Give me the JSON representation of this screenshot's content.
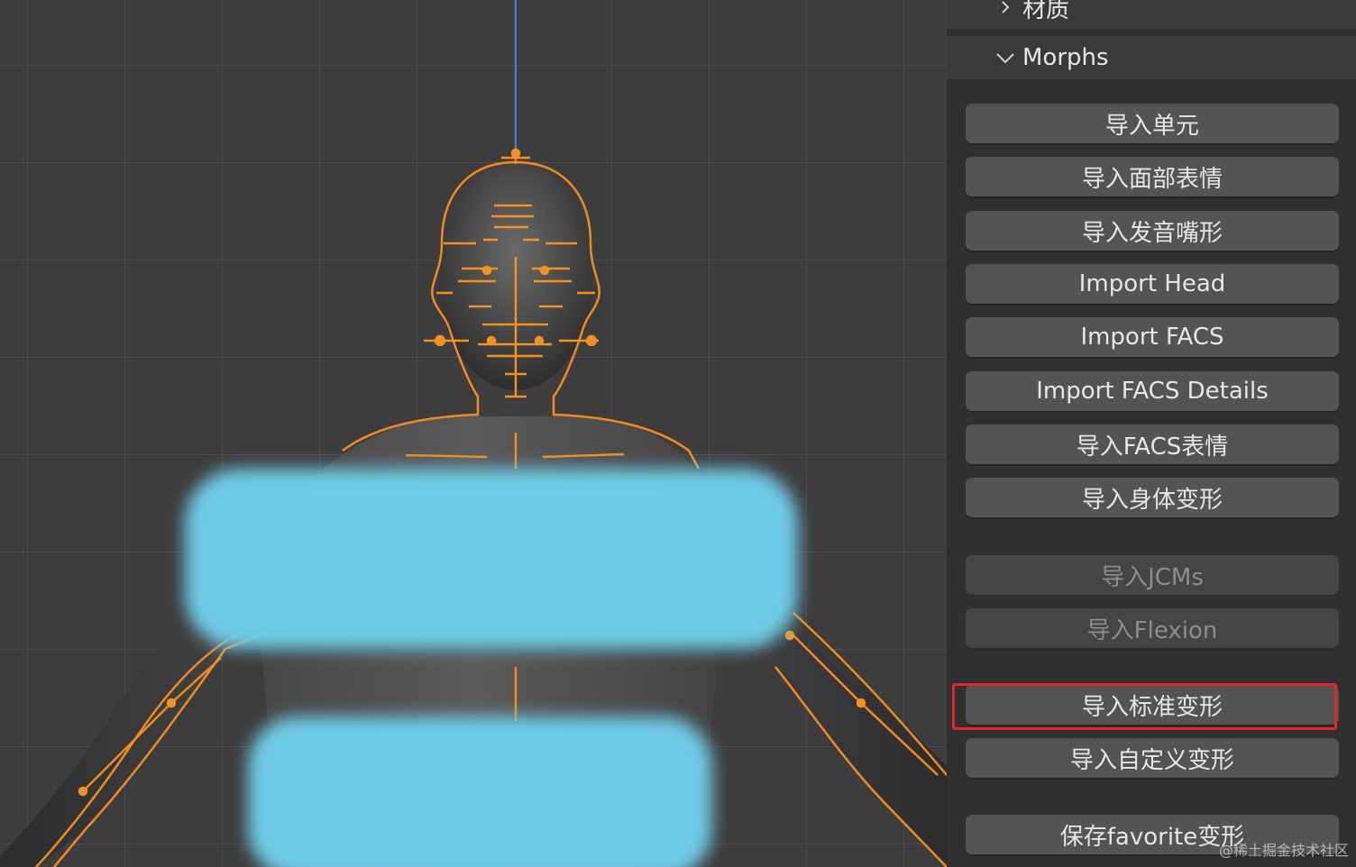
{
  "panel": {
    "sections": [
      {
        "label": "材质",
        "expanded": false
      },
      {
        "label": "Morphs",
        "expanded": true
      }
    ],
    "buttons": [
      {
        "label": "导入单元",
        "enabled": true
      },
      {
        "label": "导入面部表情",
        "enabled": true
      },
      {
        "label": "导入发音嘴形",
        "enabled": true
      },
      {
        "label": "Import Head",
        "enabled": true
      },
      {
        "label": "Import FACS",
        "enabled": true
      },
      {
        "label": "Import FACS Details",
        "enabled": true
      },
      {
        "label": "导入FACS表情",
        "enabled": true
      },
      {
        "label": "导入身体变形",
        "enabled": true
      },
      {
        "label": "导入JCMs",
        "enabled": false
      },
      {
        "label": "导入Flexion",
        "enabled": false
      },
      {
        "label": "导入标准变形",
        "enabled": true,
        "highlighted": true
      },
      {
        "label": "导入自定义变形",
        "enabled": true
      },
      {
        "label": "保存favorite变形",
        "enabled": true
      }
    ]
  },
  "watermark": "@稀土掘金技术社区",
  "colors": {
    "viewport_bg": "#3d3d3d",
    "panel_bg": "#303030",
    "button_bg": "#545454",
    "rig_orange": "#f28a1e",
    "redaction_blue": "#6ecbe6",
    "highlight_red": "#e6262a"
  }
}
